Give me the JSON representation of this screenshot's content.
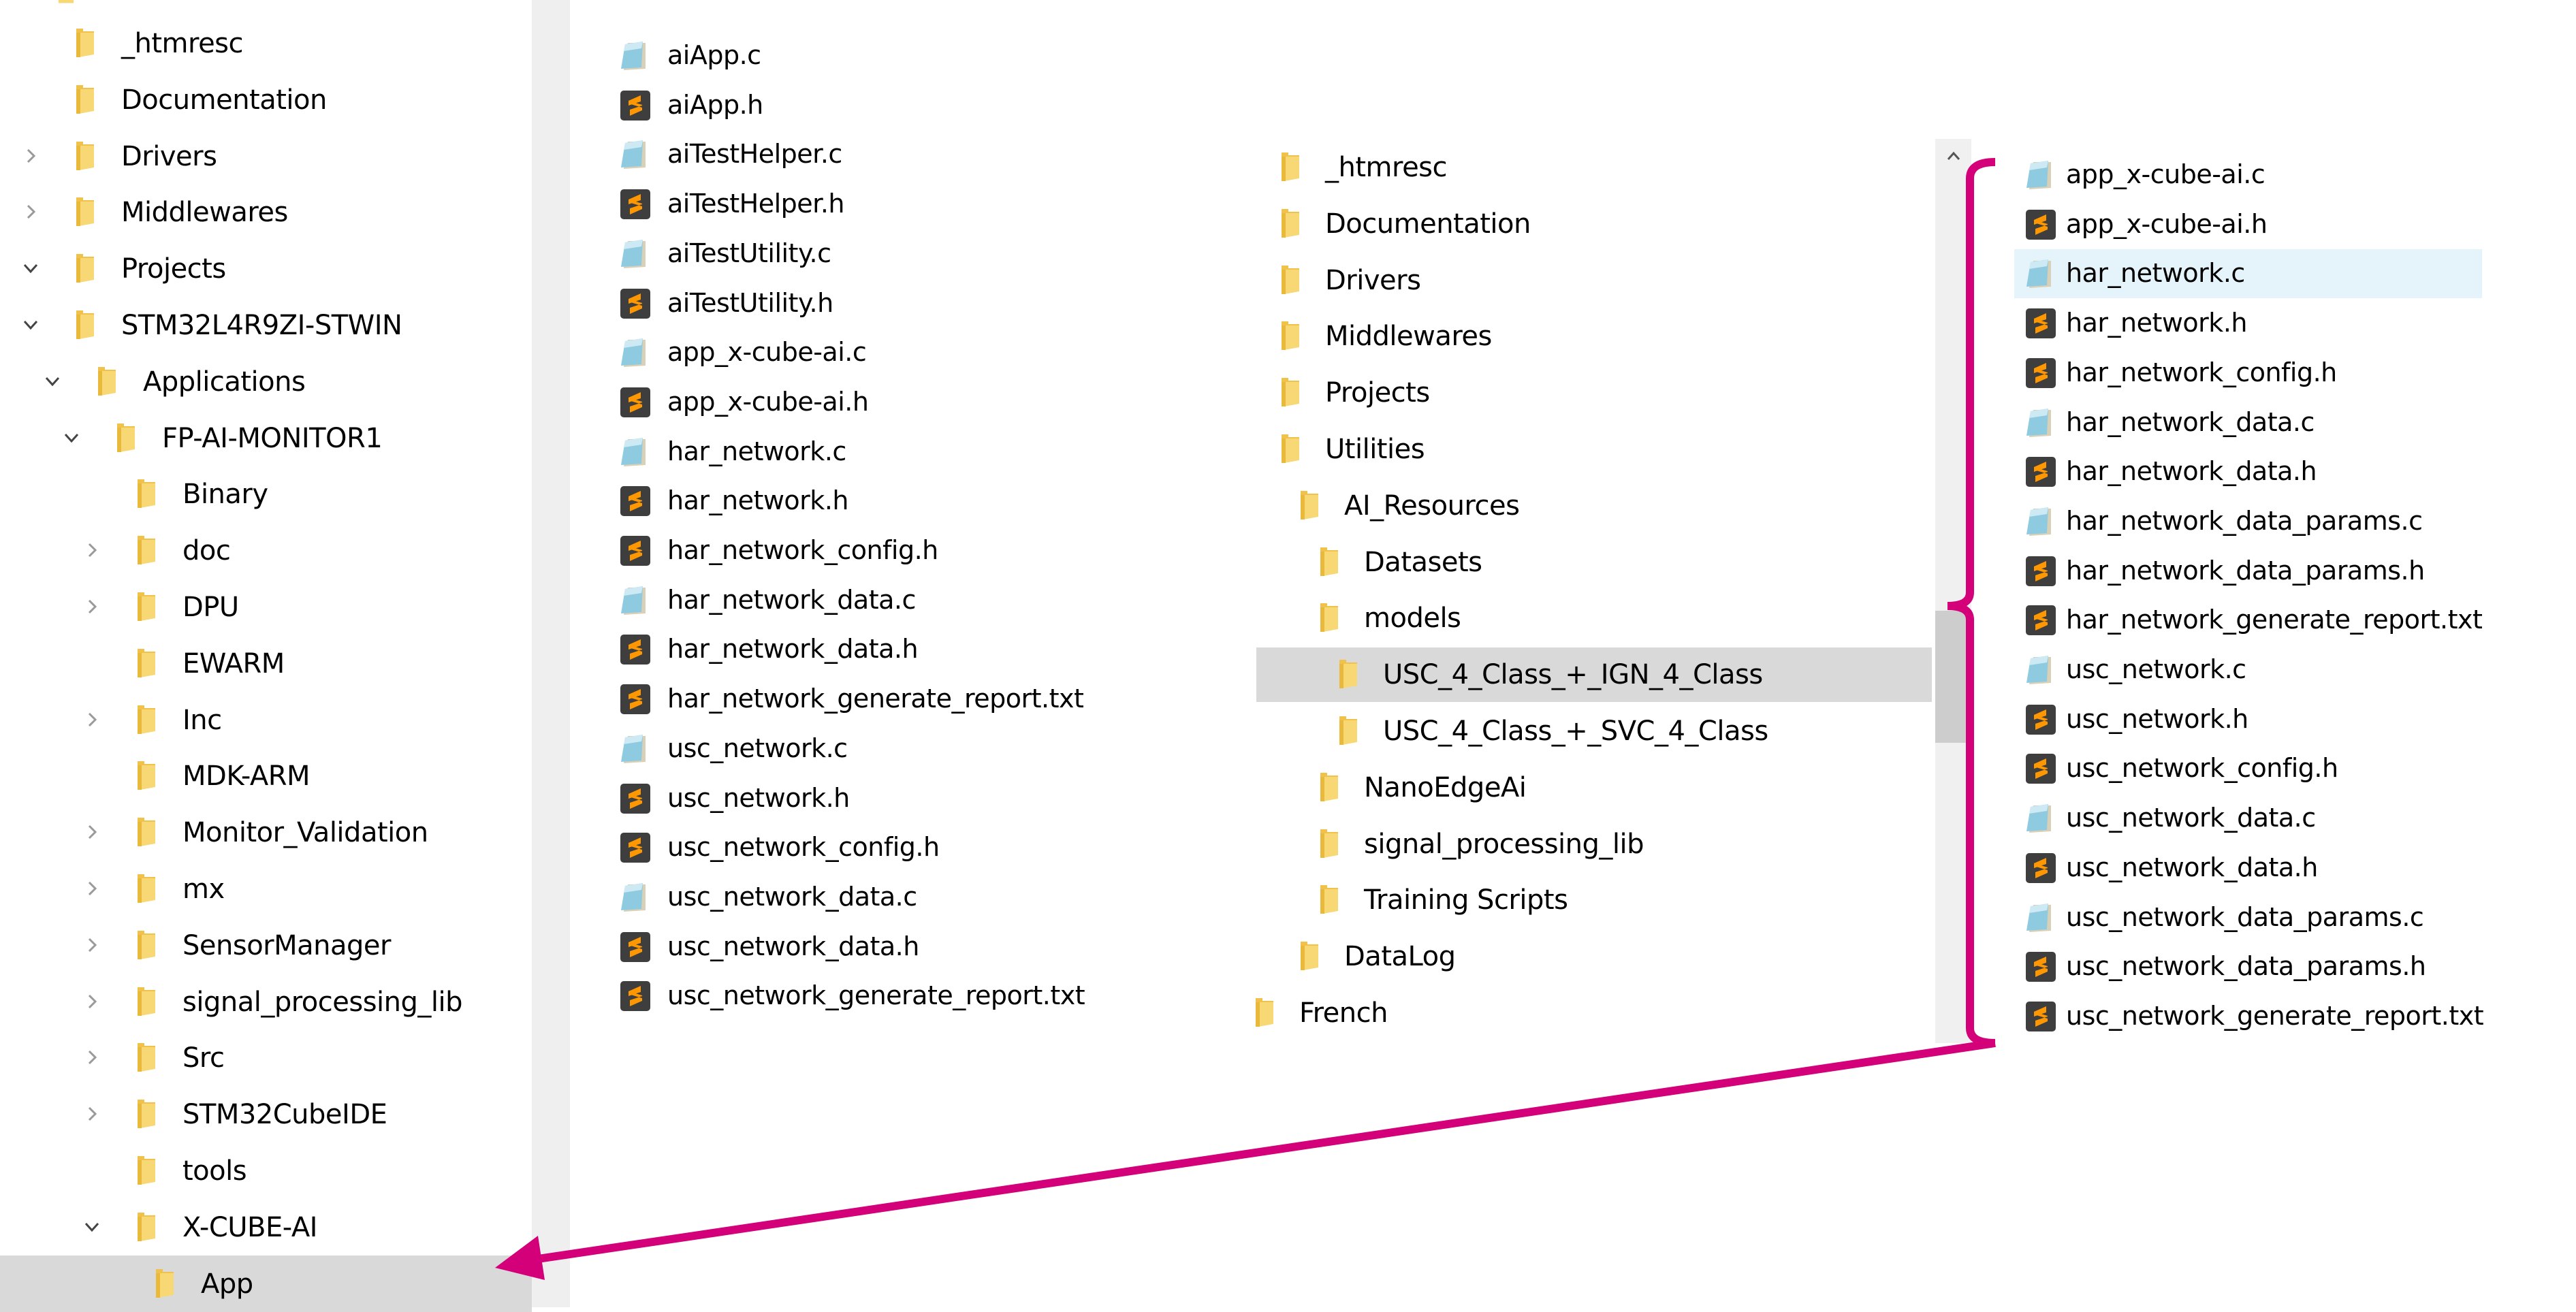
{
  "nav_tree": {
    "items": [
      {
        "label": "_htmresc",
        "level": 0,
        "expander": "none"
      },
      {
        "label": "Documentation",
        "level": 0,
        "expander": "none"
      },
      {
        "label": "Drivers",
        "level": 0,
        "expander": "collapsed"
      },
      {
        "label": "Middlewares",
        "level": 0,
        "expander": "collapsed"
      },
      {
        "label": "Projects",
        "level": 0,
        "expander": "expanded"
      },
      {
        "label": "STM32L4R9ZI-STWIN",
        "level": 1,
        "expander": "expanded"
      },
      {
        "label": "Applications",
        "level": 2,
        "expander": "expanded"
      },
      {
        "label": "FP-AI-MONITOR1",
        "level": 3,
        "expander": "expanded"
      },
      {
        "label": "Binary",
        "level": 4,
        "expander": "none"
      },
      {
        "label": "doc",
        "level": 4,
        "expander": "collapsed"
      },
      {
        "label": "DPU",
        "level": 4,
        "expander": "collapsed"
      },
      {
        "label": "EWARM",
        "level": 4,
        "expander": "none"
      },
      {
        "label": "Inc",
        "level": 4,
        "expander": "collapsed"
      },
      {
        "label": "MDK-ARM",
        "level": 4,
        "expander": "none"
      },
      {
        "label": "Monitor_Validation",
        "level": 4,
        "expander": "collapsed"
      },
      {
        "label": "mx",
        "level": 4,
        "expander": "collapsed"
      },
      {
        "label": "SensorManager",
        "level": 4,
        "expander": "collapsed"
      },
      {
        "label": "signal_processing_lib",
        "level": 4,
        "expander": "collapsed"
      },
      {
        "label": "Src",
        "level": 4,
        "expander": "collapsed"
      },
      {
        "label": "STM32CubeIDE",
        "level": 4,
        "expander": "collapsed"
      },
      {
        "label": "tools",
        "level": 4,
        "expander": "none"
      },
      {
        "label": "X-CUBE-AI",
        "level": 4,
        "expander": "expanded"
      },
      {
        "label": "App",
        "level": 5,
        "expander": "none",
        "selected": true
      }
    ]
  },
  "app_files": {
    "items": [
      {
        "name": "aiApp.c",
        "icon": "c-source-icon"
      },
      {
        "name": "aiApp.h",
        "icon": "sublime-file-icon"
      },
      {
        "name": "aiTestHelper.c",
        "icon": "c-source-icon"
      },
      {
        "name": "aiTestHelper.h",
        "icon": "sublime-file-icon"
      },
      {
        "name": "aiTestUtility.c",
        "icon": "c-source-icon"
      },
      {
        "name": "aiTestUtility.h",
        "icon": "sublime-file-icon"
      },
      {
        "name": "app_x-cube-ai.c",
        "icon": "c-source-icon"
      },
      {
        "name": "app_x-cube-ai.h",
        "icon": "sublime-file-icon"
      },
      {
        "name": "har_network.c",
        "icon": "c-source-icon"
      },
      {
        "name": "har_network.h",
        "icon": "sublime-file-icon"
      },
      {
        "name": "har_network_config.h",
        "icon": "sublime-file-icon"
      },
      {
        "name": "har_network_data.c",
        "icon": "c-source-icon"
      },
      {
        "name": "har_network_data.h",
        "icon": "sublime-file-icon"
      },
      {
        "name": "har_network_generate_report.txt",
        "icon": "sublime-file-icon"
      },
      {
        "name": "usc_network.c",
        "icon": "c-source-icon"
      },
      {
        "name": "usc_network.h",
        "icon": "sublime-file-icon"
      },
      {
        "name": "usc_network_config.h",
        "icon": "sublime-file-icon"
      },
      {
        "name": "usc_network_data.c",
        "icon": "c-source-icon"
      },
      {
        "name": "usc_network_data.h",
        "icon": "sublime-file-icon"
      },
      {
        "name": "usc_network_generate_report.txt",
        "icon": "sublime-file-icon"
      }
    ]
  },
  "resources_tree": {
    "items": [
      {
        "label": "_htmresc",
        "level": 0
      },
      {
        "label": "Documentation",
        "level": 0
      },
      {
        "label": "Drivers",
        "level": 0
      },
      {
        "label": "Middlewares",
        "level": 0
      },
      {
        "label": "Projects",
        "level": 0
      },
      {
        "label": "Utilities",
        "level": 0
      },
      {
        "label": "AI_Resources",
        "level": 1
      },
      {
        "label": "Datasets",
        "level": 2
      },
      {
        "label": "models",
        "level": 2
      },
      {
        "label": "USC_4_Class_+_IGN_4_Class",
        "level": 3,
        "selected": true
      },
      {
        "label": "USC_4_Class_+_SVC_4_Class",
        "level": 3
      },
      {
        "label": "NanoEdgeAi",
        "level": 2
      },
      {
        "label": "signal_processing_lib",
        "level": 2
      },
      {
        "label": "Training Scripts",
        "level": 2
      },
      {
        "label": "DataLog",
        "level": 1
      },
      {
        "label": "French",
        "level": -1
      }
    ]
  },
  "model_files": {
    "items": [
      {
        "name": "app_x-cube-ai.c",
        "icon": "c-source-icon"
      },
      {
        "name": "app_x-cube-ai.h",
        "icon": "sublime-file-icon"
      },
      {
        "name": "har_network.c",
        "icon": "c-source-icon",
        "hovered": true
      },
      {
        "name": "har_network.h",
        "icon": "sublime-file-icon"
      },
      {
        "name": "har_network_config.h",
        "icon": "sublime-file-icon"
      },
      {
        "name": "har_network_data.c",
        "icon": "c-source-icon"
      },
      {
        "name": "har_network_data.h",
        "icon": "sublime-file-icon"
      },
      {
        "name": "har_network_data_params.c",
        "icon": "c-source-icon"
      },
      {
        "name": "har_network_data_params.h",
        "icon": "sublime-file-icon"
      },
      {
        "name": "har_network_generate_report.txt",
        "icon": "sublime-file-icon"
      },
      {
        "name": "usc_network.c",
        "icon": "c-source-icon"
      },
      {
        "name": "usc_network.h",
        "icon": "sublime-file-icon"
      },
      {
        "name": "usc_network_config.h",
        "icon": "sublime-file-icon"
      },
      {
        "name": "usc_network_data.c",
        "icon": "c-source-icon"
      },
      {
        "name": "usc_network_data.h",
        "icon": "sublime-file-icon"
      },
      {
        "name": "usc_network_data_params.c",
        "icon": "c-source-icon"
      },
      {
        "name": "usc_network_data_params.h",
        "icon": "sublime-file-icon"
      },
      {
        "name": "usc_network_generate_report.txt",
        "icon": "sublime-file-icon"
      }
    ]
  },
  "annotation": {
    "color": "#d4007a",
    "bracket": "right-column-bracket",
    "arrow_target": "App"
  },
  "colors": {
    "selected_row": "#d9d9d9",
    "hover_row": "#e5f3fb",
    "folder": "#f8d775",
    "sublime_bg": "#3e3e3e",
    "sublime_s": "#ff9800",
    "notepad": "#8fcbe0"
  }
}
